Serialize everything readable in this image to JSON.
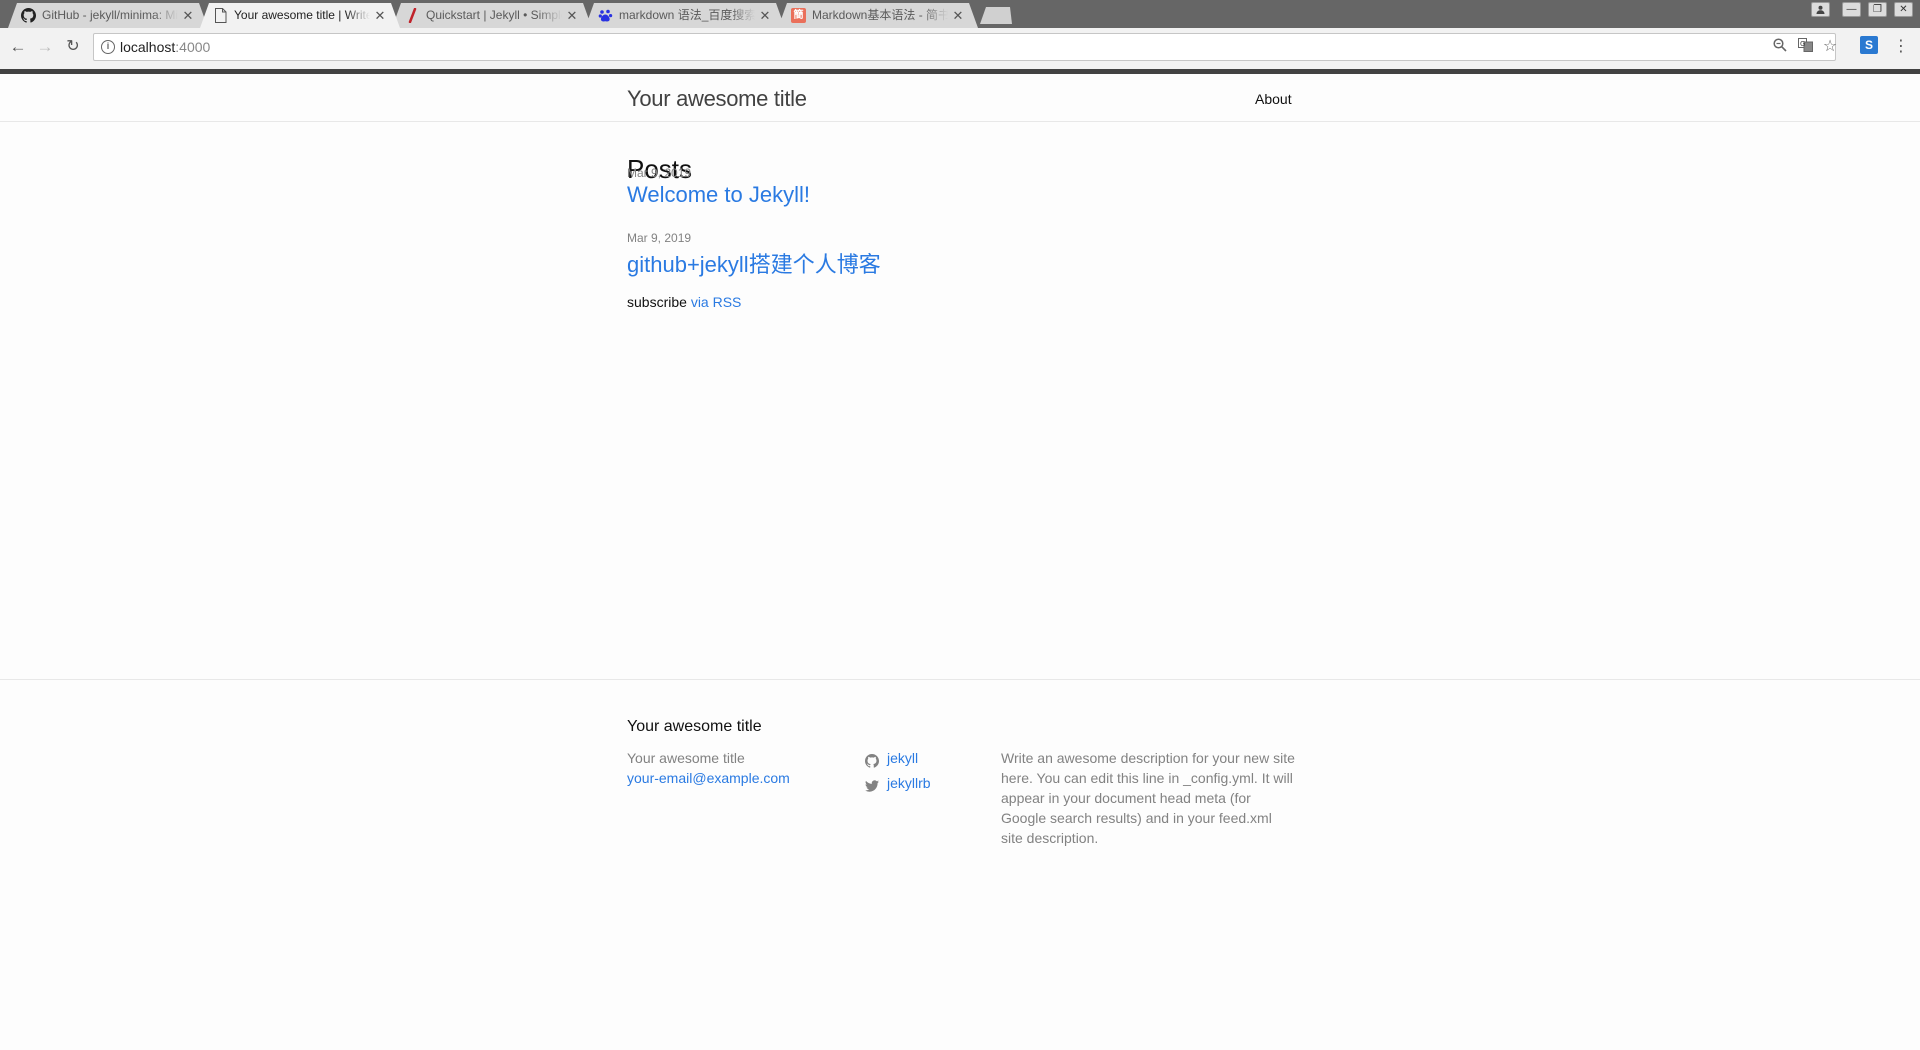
{
  "browser": {
    "tabs": [
      {
        "title": "GitHub - jekyll/minima: Minima is a one-size-fits-all Jekyll theme",
        "icon": "github-icon",
        "active": false
      },
      {
        "title": "Your awesome title | Write an awesome description",
        "icon": "page-icon",
        "active": true
      },
      {
        "title": "Quickstart | Jekyll • Simple, blog-aware, static sites",
        "icon": "jekyll-icon",
        "active": false
      },
      {
        "title": "markdown 语法_百度搜索",
        "icon": "baidu-icon",
        "active": false
      },
      {
        "title": "Markdown基本语法 - 简书",
        "icon": "jianshu-icon",
        "active": false
      }
    ],
    "url_host": "localhost",
    "url_port": ":4000"
  },
  "header": {
    "site_title": "Your awesome title",
    "nav": [
      "About"
    ]
  },
  "main": {
    "heading": "Posts",
    "posts": [
      {
        "date": "Mar 9, 2019",
        "title": "Welcome to Jekyll!"
      },
      {
        "date": "Mar 9, 2019",
        "title": "github+jekyll搭建个人博客"
      }
    ],
    "rss_prefix": "subscribe",
    "rss_link": "via RSS"
  },
  "footer": {
    "heading": "Your awesome title",
    "name": "Your awesome title",
    "email": "your-email@example.com",
    "social": [
      {
        "icon": "github-icon",
        "label": "jekyll"
      },
      {
        "icon": "twitter-icon",
        "label": "jekyllrb"
      }
    ],
    "description": "Write an awesome description for your new site here. You can edit this line in _config.yml. It will appear in your document head meta (for Google search results) and in your feed.xml site description."
  },
  "colors": {
    "link": "#2a7ae2",
    "text": "#111111",
    "muted": "#828282",
    "header_border": "#424242"
  }
}
